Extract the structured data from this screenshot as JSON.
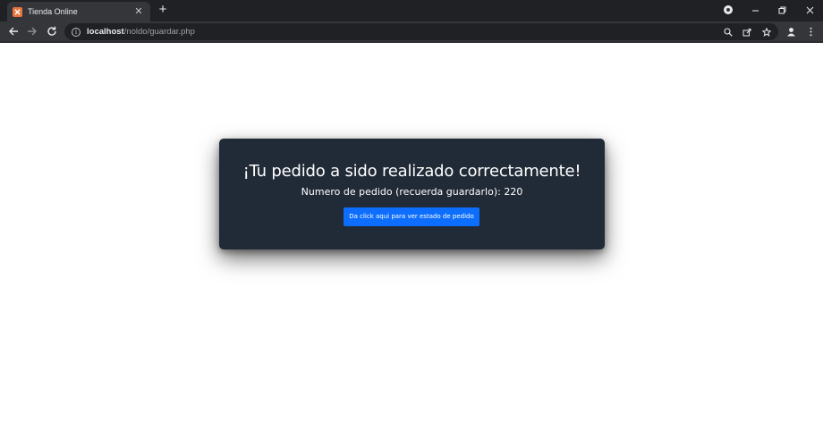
{
  "browser": {
    "tab": {
      "title": "Tienda Online",
      "favicon": "xampp-icon"
    },
    "new_tab_label": "+",
    "address": {
      "host": "localhost",
      "path": "/noldo/guardar.php"
    }
  },
  "page": {
    "card": {
      "title": "¡Tu pedido a sido realizado correctamente!",
      "order_line": "Numero de pedido (recuerda guardarlo): 220",
      "status_button": "Da click aqui para ver estado de pedido"
    }
  },
  "colors": {
    "card_bg": "#212b37",
    "button_bg": "#0d6efd",
    "chrome_dark": "#202124",
    "chrome_toolbar": "#35363a"
  }
}
